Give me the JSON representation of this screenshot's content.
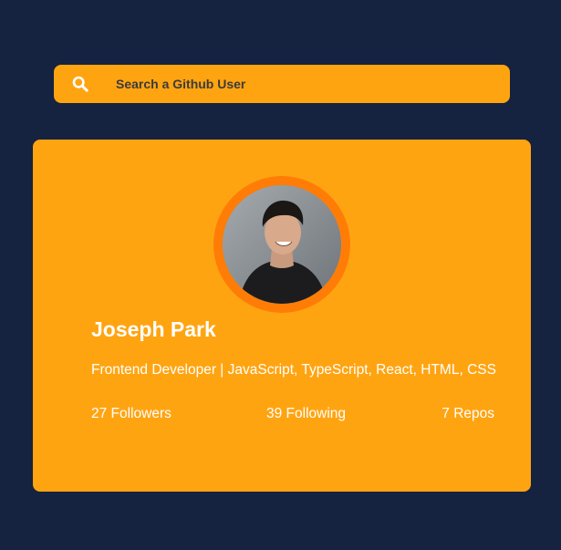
{
  "search": {
    "placeholder": "Search a Github User",
    "icon": "search-icon"
  },
  "profile": {
    "name": "Joseph Park",
    "bio": "Frontend Developer | JavaScript, TypeScript, React, HTML, CSS",
    "stats": {
      "followers": "27 Followers",
      "following": "39 Following",
      "repos": "7 Repos"
    }
  },
  "colors": {
    "background": "#152240",
    "accent": "#ffa411",
    "avatar_ring": "#ff7d06",
    "text": "#ffffff"
  }
}
